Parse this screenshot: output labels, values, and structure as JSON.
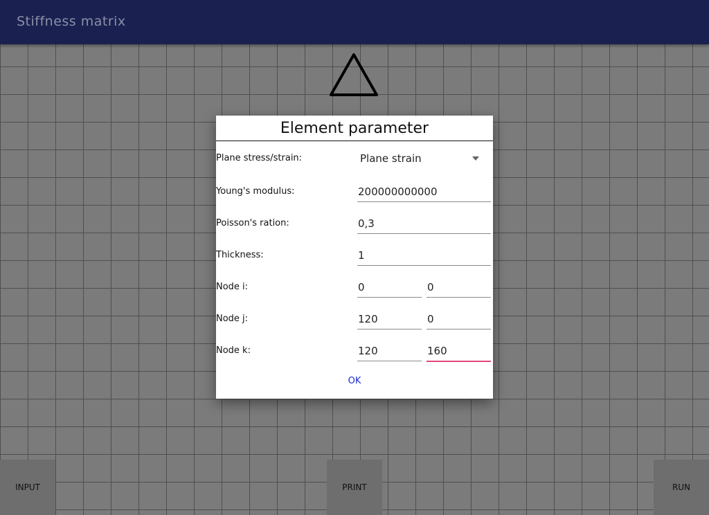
{
  "app_bar": {
    "title": "Stiffness matrix"
  },
  "dialog": {
    "title": "Element parameter",
    "plane_label": "Plane stress/strain:",
    "plane_value": "Plane strain",
    "youngs_label": "Young's modulus:",
    "youngs_value": "200000000000",
    "poisson_label": "Poisson's ration:",
    "poisson_value": "0,3",
    "thickness_label": "Thickness:",
    "thickness_value": "1",
    "node_i_label": "Node i:",
    "node_i_x": "0",
    "node_i_y": "0",
    "node_j_label": "Node j:",
    "node_j_x": "120",
    "node_j_y": "0",
    "node_k_label": "Node k:",
    "node_k_x": "120",
    "node_k_y": "160",
    "ok_label": "OK"
  },
  "bottom_buttons": {
    "input": "INPUT",
    "print": "PRINT",
    "run": "RUN"
  },
  "colors": {
    "app_bar": "#1a2150",
    "grid_background": "#7b7b7b",
    "grid_line": "#4f4f4f",
    "focused_underline": "#e2487a",
    "ok_text": "#1a2bd6"
  },
  "icons": {
    "plane_dropdown": "triangle-down-icon",
    "element_shape": "triangle-element-icon"
  }
}
